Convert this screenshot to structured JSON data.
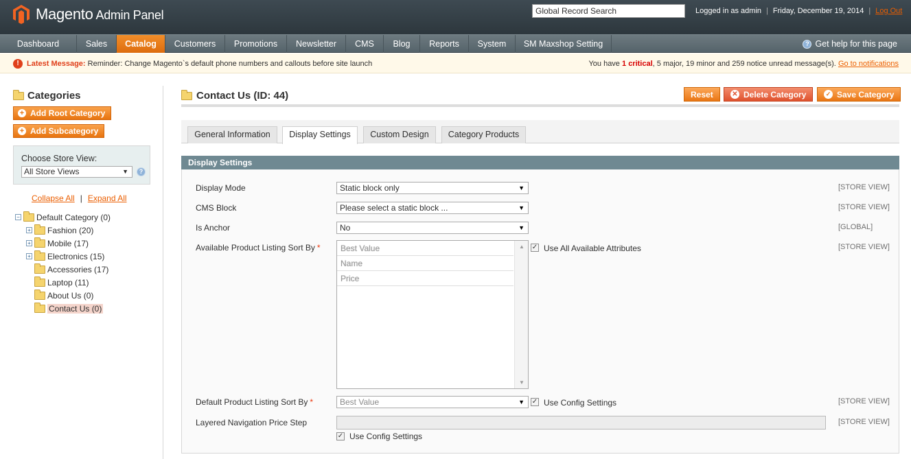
{
  "header": {
    "app_name": "Magento",
    "app_sub": "Admin Panel",
    "search_value": "Global Record Search",
    "logged_in": "Logged in as admin",
    "date": "Friday, December 19, 2014",
    "logout": "Log Out"
  },
  "nav": {
    "items": [
      "Dashboard",
      "Sales",
      "Catalog",
      "Customers",
      "Promotions",
      "Newsletter",
      "CMS",
      "Blog",
      "Reports",
      "System",
      "SM Maxshop Setting"
    ],
    "active": "Catalog",
    "help": "Get help for this page"
  },
  "message": {
    "prefix": "Latest Message:",
    "text": "Reminder: Change Magento`s default phone numbers and callouts before site launch",
    "you_have": "You have",
    "critical_count": "1",
    "critical_word": "critical",
    "major": ", 5 major, ",
    "minor": "19 minor and ",
    "notice": "259 notice unread message(s).",
    "link": "Go to notifications"
  },
  "sidebar": {
    "title": "Categories",
    "add_root": "Add Root Category",
    "add_sub": "Add Subcategory",
    "store_label": "Choose Store View:",
    "store_value": "All Store Views",
    "collapse_all": "Collapse All",
    "expand_all": "Expand All",
    "tree": [
      {
        "label": "Default Category (0)"
      },
      {
        "label": "Fashion (20)"
      },
      {
        "label": "Mobile (17)"
      },
      {
        "label": "Electronics (15)"
      },
      {
        "label": "Accessories (17)"
      },
      {
        "label": "Laptop (11)"
      },
      {
        "label": "About Us (0)"
      },
      {
        "label": "Contact Us (0)"
      }
    ]
  },
  "main": {
    "title": "Contact Us (ID: 44)",
    "buttons": {
      "reset": "Reset",
      "delete": "Delete Category",
      "save": "Save Category"
    },
    "tabs": [
      "General Information",
      "Display Settings",
      "Custom Design",
      "Category Products"
    ],
    "active_tab": "Display Settings",
    "section_title": "Display Settings",
    "fields": {
      "display_mode": {
        "label": "Display Mode",
        "value": "Static block only",
        "scope": "[STORE VIEW]"
      },
      "cms_block": {
        "label": "CMS Block",
        "value": "Please select a static block ...",
        "scope": "[STORE VIEW]"
      },
      "is_anchor": {
        "label": "Is Anchor",
        "value": "No",
        "scope": "[GLOBAL]"
      },
      "sort_by": {
        "label": "Available Product Listing Sort By",
        "options": [
          "Best Value",
          "Name",
          "Price"
        ],
        "checkbox": "Use All Available Attributes",
        "checked": true,
        "scope": "[STORE VIEW]"
      },
      "default_sort": {
        "label": "Default Product Listing Sort By",
        "value": "Best Value",
        "checkbox": "Use Config Settings",
        "checked": true,
        "scope": "[STORE VIEW]"
      },
      "price_step": {
        "label": "Layered Navigation Price Step",
        "value": "",
        "checkbox": "Use Config Settings",
        "checked": true,
        "scope": "[STORE VIEW]"
      }
    }
  },
  "colors": {
    "accent": "#eb5e00",
    "header_bg": "#2d373d",
    "section_head": "#6f8992"
  }
}
